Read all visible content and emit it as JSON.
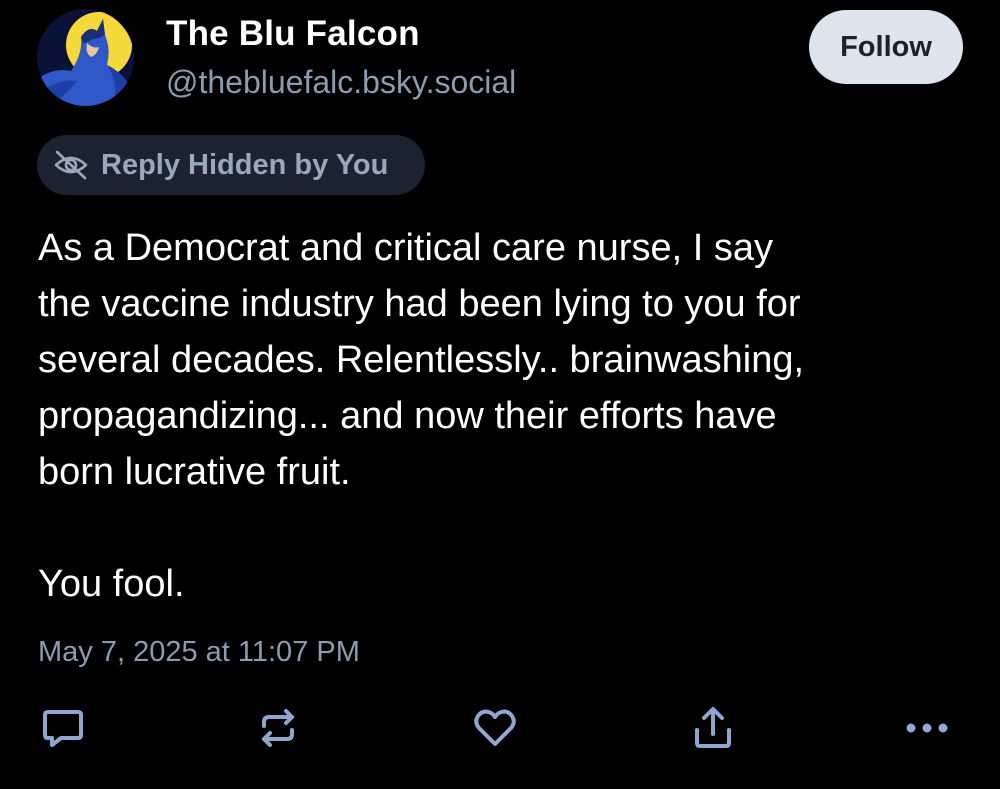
{
  "author": {
    "display_name": "The Blu Falcon",
    "handle": "@thebluefalc.bsky.social"
  },
  "follow_button": {
    "label": "Follow"
  },
  "moderation_badge": {
    "label": "Reply Hidden by You",
    "icon": "eye-slash-icon"
  },
  "post": {
    "paragraphs": [
      "As a Democrat and critical care nurse, I say\nthe vaccine industry had been lying to you for\nseveral decades. Relentlessly.. brainwashing,\npropagandizing... and now their efforts have\nborn lucrative fruit.",
      "You fool."
    ],
    "timestamp": "May 7, 2025 at 11:07 PM"
  },
  "actions": [
    {
      "name": "reply",
      "icon": "speech-bubble-icon"
    },
    {
      "name": "repost",
      "icon": "repost-arrows-icon"
    },
    {
      "name": "like",
      "icon": "heart-icon"
    },
    {
      "name": "share",
      "icon": "share-upload-icon"
    },
    {
      "name": "more",
      "icon": "ellipsis-icon"
    }
  ],
  "colors": {
    "background": "#000000",
    "text_primary": "#ffffff",
    "text_secondary": "#8c9bb0",
    "icon": "#8ea7cf",
    "badge_background": "#1b2330",
    "follow_background": "#dde4ec",
    "avatar_yellow": "#f5d93a"
  }
}
